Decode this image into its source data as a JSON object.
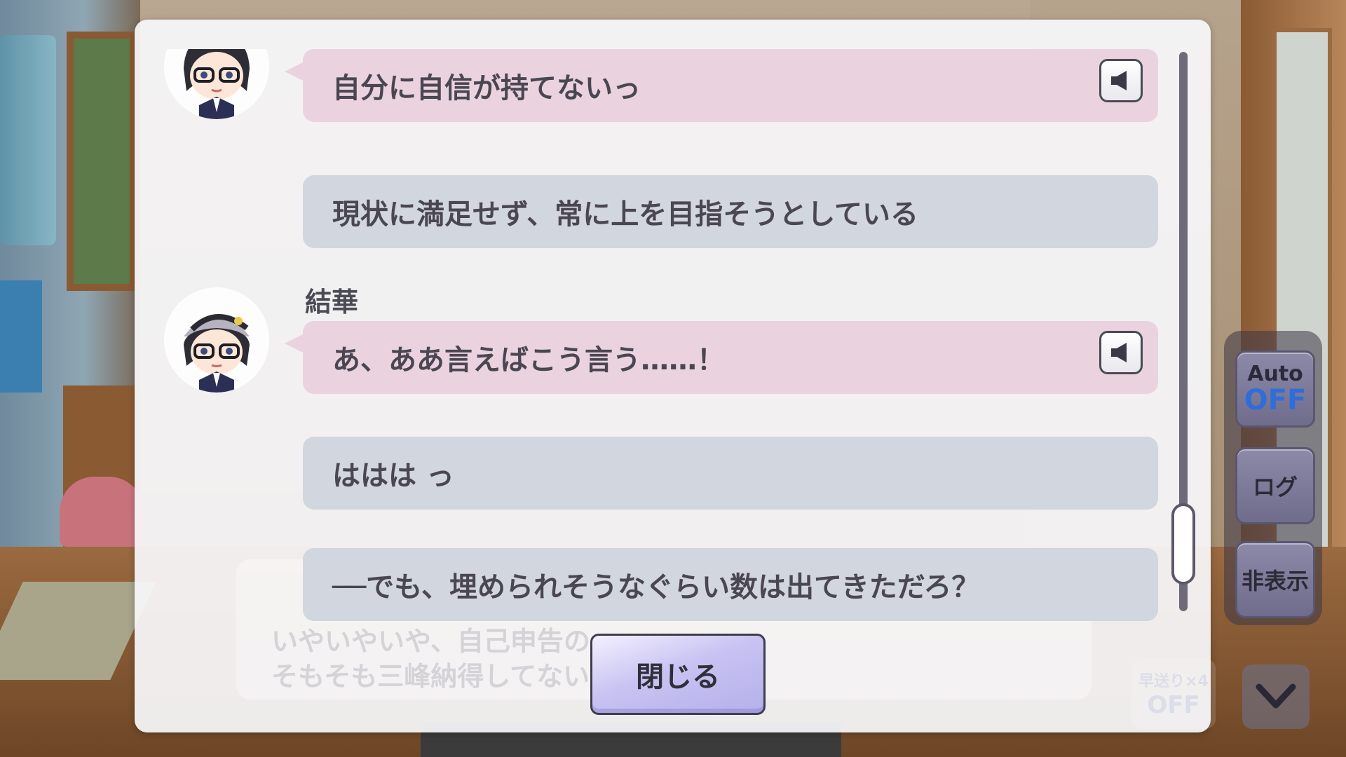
{
  "log": {
    "messages": [
      {
        "speaker": "",
        "style": "pink",
        "text": "自分に自信が持てないっ",
        "has_voice": true,
        "show_avatar": true
      },
      {
        "speaker": "",
        "style": "gray",
        "text": "現状に満足せず、常に上を目指そうとしている",
        "has_voice": false,
        "show_avatar": false
      },
      {
        "speaker": "結華",
        "style": "pink",
        "text": "あ、ああ言えばこう言う……！",
        "has_voice": true,
        "show_avatar": true
      },
      {
        "speaker": "",
        "style": "gray",
        "text": "ははは っ",
        "has_voice": false,
        "show_avatar": false
      },
      {
        "speaker": "",
        "style": "gray",
        "text": "──でも、埋められそうなぐらい数は出てきただろ？",
        "has_voice": false,
        "show_avatar": false
      }
    ],
    "scroll_position": 0.85
  },
  "close_button_label": "閉じる",
  "underlying_message": {
    "line1": "いやいやいや、自己申告の",
    "line2": "そもそも三峰納得してない"
  },
  "side_controls": {
    "auto_label": "Auto",
    "auto_state": "OFF",
    "log_label": "ログ",
    "hide_label": "非表示"
  },
  "skip": {
    "label": "早送り×4",
    "state": "OFF"
  },
  "colors": {
    "pink_bubble": "#ead3df",
    "gray_bubble": "#d2d6de",
    "auto_off": "#2f6ed8",
    "close_button": "#c8c3f2"
  }
}
